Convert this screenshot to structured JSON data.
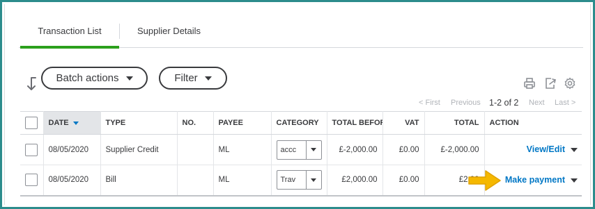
{
  "tabs": [
    {
      "label": "Transaction List",
      "active": true
    },
    {
      "label": "Supplier Details",
      "active": false
    }
  ],
  "toolbar": {
    "batch_actions_label": "Batch actions",
    "filter_label": "Filter",
    "icons": [
      "print-icon",
      "export-icon",
      "settings-gear-icon"
    ]
  },
  "pager": {
    "first": "< First",
    "previous": "Previous",
    "range": "1-2 of 2",
    "next": "Next",
    "last": "Last >"
  },
  "table": {
    "columns": [
      "DATE",
      "TYPE",
      "NO.",
      "PAYEE",
      "CATEGORY",
      "TOTAL BEFORE",
      "VAT",
      "TOTAL",
      "ACTION"
    ],
    "rows": [
      {
        "date": "08/05/2020",
        "type": "Supplier Credit",
        "no": "",
        "payee": "ML",
        "category": "accc",
        "total_before": "£-2,000.00",
        "vat": "£0.00",
        "total": "£-2,000.00",
        "action": "View/Edit"
      },
      {
        "date": "08/05/2020",
        "type": "Bill",
        "no": "",
        "payee": "ML",
        "category": "Trav",
        "total_before": "£2,000.00",
        "vat": "£0.00",
        "total": "£2,00",
        "action": "Make payment"
      }
    ]
  },
  "colors": {
    "frame": "#2c8c8c",
    "active_tab": "#2ca01c",
    "link": "#0077c5",
    "arrow": "#f5b800"
  }
}
